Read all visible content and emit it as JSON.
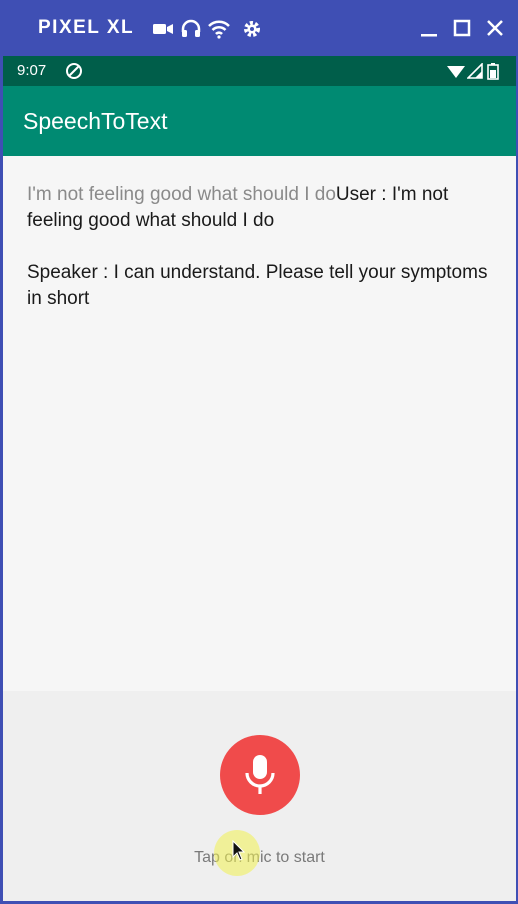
{
  "window": {
    "device_name": "PIXEL XL",
    "icons": [
      "video-camera-icon",
      "headphones-icon",
      "wifi-icon",
      "gear-icon"
    ],
    "controls": [
      "minimize-icon",
      "maximize-icon",
      "close-icon"
    ],
    "accent": "#3f4fb4"
  },
  "status_bar": {
    "time": "9:07",
    "icons": [
      "sync-disabled-icon",
      "wifi-icon",
      "signal-icon",
      "battery-icon"
    ],
    "color": "#005e4a"
  },
  "app_bar": {
    "title": "SpeechToText",
    "color": "#008a72"
  },
  "conversation": {
    "partial_text": "I'm not feeling good what should I do",
    "user_text": "User : I'm not feeling good what should I do",
    "speaker_text": "Speaker : I can understand. Please tell your symptoms in short"
  },
  "voice_panel": {
    "mic_icon": "microphone-icon",
    "mic_color": "#f04b4b",
    "hint": "Tap on mic to start"
  }
}
